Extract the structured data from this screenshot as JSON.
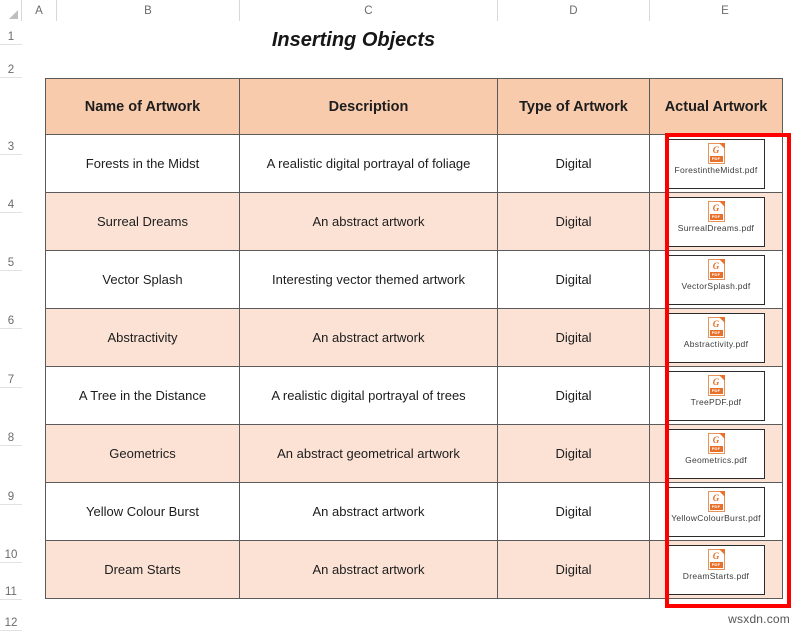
{
  "spreadsheet": {
    "column_headers": [
      "A",
      "B",
      "C",
      "D",
      "E"
    ],
    "row_headers": [
      "1",
      "2",
      "3",
      "4",
      "5",
      "6",
      "7",
      "8",
      "9",
      "10",
      "11",
      "12"
    ],
    "title": "Inserting Objects"
  },
  "table": {
    "headers": [
      "Name of Artwork",
      "Description",
      "Type of Artwork",
      "Actual Artwork"
    ],
    "rows": [
      {
        "name": "Forests in the Midst",
        "description": "A realistic digital portrayal of  foliage",
        "type": "Digital",
        "artwork_file": "ForestintheMidst.pdf",
        "icon": "pdf-file-icon"
      },
      {
        "name": "Surreal Dreams",
        "description": "An abstract artwork",
        "type": "Digital",
        "artwork_file": "SurrealDreams.pdf",
        "icon": "pdf-file-icon"
      },
      {
        "name": "Vector Splash",
        "description": "Interesting vector themed artwork",
        "type": "Digital",
        "artwork_file": "VectorSplash.pdf",
        "icon": "pdf-file-icon"
      },
      {
        "name": "Abstractivity",
        "description": "An abstract artwork",
        "type": "Digital",
        "artwork_file": "Abstractivity.pdf",
        "icon": "pdf-file-icon"
      },
      {
        "name": "A Tree in the Distance",
        "description": "A realistic digital portrayal of trees",
        "type": "Digital",
        "artwork_file": "TreePDF.pdf",
        "icon": "pdf-file-icon"
      },
      {
        "name": "Geometrics",
        "description": "An abstract geometrical artwork",
        "type": "Digital",
        "artwork_file": "Geometrics.pdf",
        "icon": "pdf-file-icon"
      },
      {
        "name": "Yellow Colour Burst",
        "description": "An abstract artwork",
        "type": "Digital",
        "artwork_file": "YellowColourBurst.pdf",
        "icon": "pdf-file-icon"
      },
      {
        "name": "Dream Starts",
        "description": "An abstract artwork",
        "type": "Digital",
        "artwork_file": "DreamStarts.pdf",
        "icon": "pdf-file-icon"
      }
    ]
  },
  "pdf_icon": {
    "glyph": "G",
    "tag": "PDF"
  },
  "annotation": {
    "highlight_color": "#ff0000"
  },
  "watermark": "wsxdn.com",
  "colors": {
    "header_fill": "#f8cbad",
    "row_shade_fill": "#fbe2d5",
    "row_plain_fill": "#ffffff",
    "border": "#5b5b5b",
    "pdf_orange": "#e8702a"
  }
}
